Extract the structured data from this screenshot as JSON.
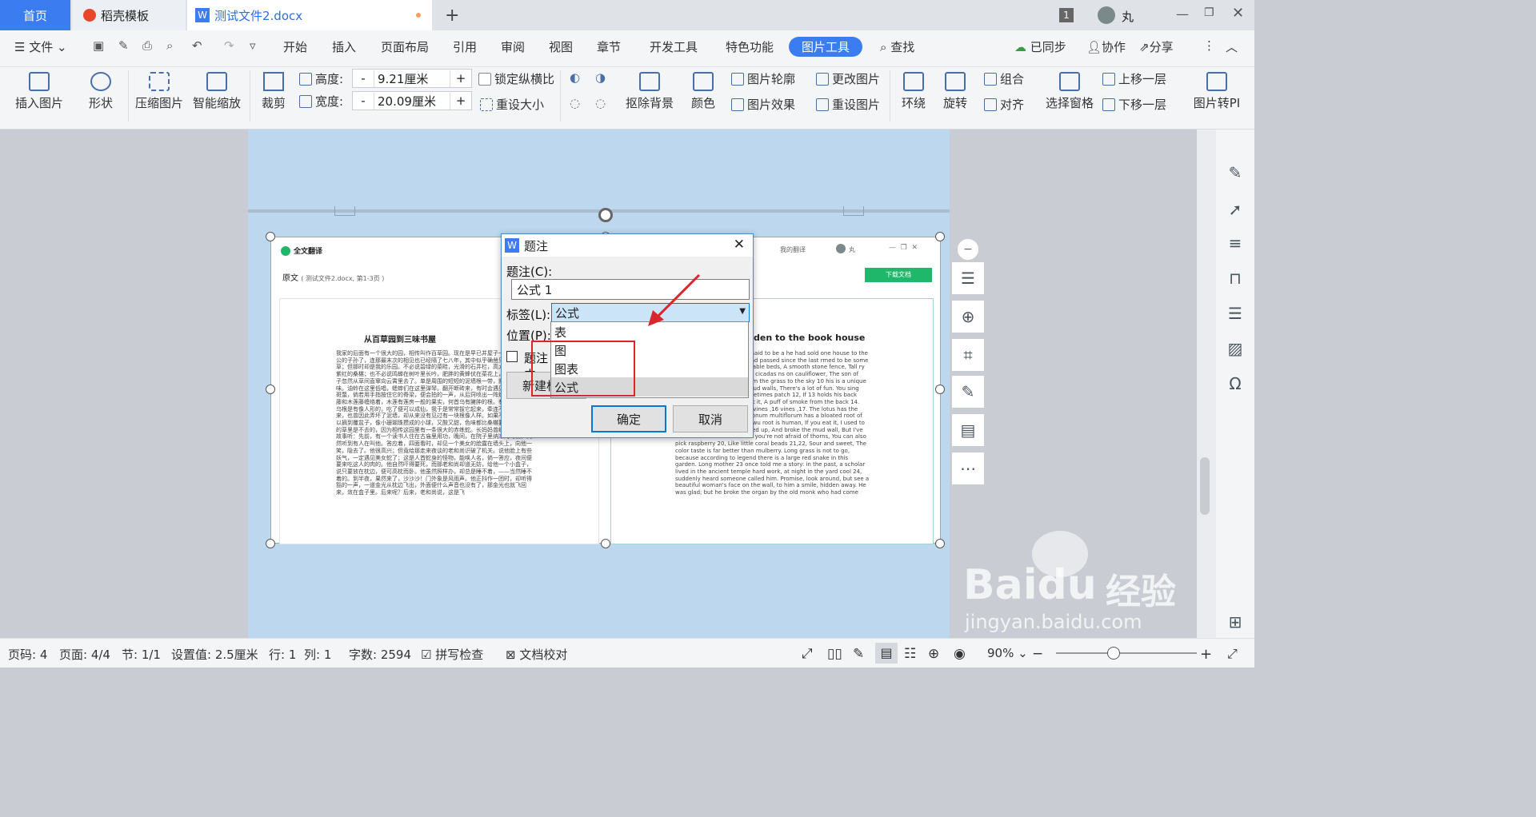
{
  "tabs": {
    "home": "首页",
    "template": "稻壳模板",
    "document": "测试文件2.docx",
    "new_tab": "+",
    "user": "丸",
    "badge": "1"
  },
  "menu": {
    "file": "文件",
    "items": [
      "开始",
      "插入",
      "页面布局",
      "引用",
      "审阅",
      "视图",
      "章节",
      "开发工具",
      "特色功能",
      "图片工具"
    ],
    "search": "查找",
    "synced": "已同步",
    "collab": "协作",
    "share": "分享"
  },
  "ribbon": {
    "insert_picture": "插入图片",
    "shape": "形状",
    "compress": "压缩图片",
    "smart_zoom": "智能缩放",
    "crop": "裁剪",
    "height_label": "高度:",
    "height_value": "9.21厘米",
    "width_label": "宽度:",
    "width_value": "20.09厘米",
    "lock_ratio": "锁定纵横比",
    "reset_size": "重设大小",
    "remove_bg": "抠除背景",
    "color": "颜色",
    "outline": "图片轮廓",
    "effect": "图片效果",
    "change_pic": "更改图片",
    "reset_pic": "重设图片",
    "wrap": "环绕",
    "rotate": "旋转",
    "group": "组合",
    "align": "对齐",
    "select_pane": "选择窗格",
    "bring_forward": "上移一层",
    "send_backward": "下移一层",
    "pic_to_pdf": "图片转PI"
  },
  "inner": {
    "app_name": "全文翻译",
    "source_label": "原文",
    "source_meta": "( 测试文件2.docx, 第1-3页 )",
    "my_translation": "我的翻译",
    "user": "丸",
    "download": "下载文档",
    "cn_title": "从百草园到三味书屋",
    "en_title": "den to the book house",
    "cn_body": "我家的后面有一个很大的园，相传叫作百草园。现在是早已并屋子一起卖给朱文公的子孙了，连那最末次的相见也已经隔了七八年，其中似乎确凿只有一些野草；但那时却是我的乐园。不必说碧绿的菜畦，光滑的石井栏，高大的皂荚树，紫红的桑椹；也不必说鸣蝉在树叶里长吟，肥胖的黄蜂伏在菜花上，轻捷的叫天子忽然从草间直窜向云霄里去了。单是周围的短短的泥墙根一带，就有无限趣味。油蛉在这里低唱，蟋蟀们在这里弹琴。翻开断砖来，有时会遇见蜈蚣；还有斑蝥，倘若用手指按住它的脊梁，便会拍的一声，从后窍喷出一阵烟雾。何首乌藤和木莲藤缠络着，木莲有莲房一般的果实，何首乌有臃肿的根。有人说，何首乌根是有像人形的，吃了便可以成仙，我于是常常拔它起来，牵连不断地拔起来，也曾因此弄坏了泥墙，却从来没有见过有一块根像人样。如果不怕刺，还可以摘到覆盆子，像小珊瑚珠攒成的小球，又酸又甜，色味都比桑椹要好得远。长的草里是不去的，因为相传这园里有一条很大的赤练蛇。长妈妈曾经讲给我一个故事听：先前，有一个读书人住在古庙里用功，晚间，在院子里纳凉的时候，突然听到有人在叫他。答应着，四面看时，却见一个美女的脸露在墙头上，向他一笑，隐去了。他很高兴；但竟给那走来夜谈的老和尚识破了机关。说他脸上有些妖气，一定遇见美女蛇了；这是人首蛇身的怪物，能唤人名，倘一答应，夜间便要来吃这人的肉的。他自然吓得要死，而那老和尚却道无妨，给他一个小盒子，说只要放在枕边，便可高枕而卧。他虽然照样办，却总是睡不着，——当然睡不着的。到半夜，果然来了，沙沙沙！门外象是风雨声。他正抖作一团时，却听得豁的一声，一道金光从枕边飞出，外面便什么声音也没有了，那金光也就飞回来，敛在盒子里。后来呢？后来，老和尚说，这是飞",
    "en_body": "behind my house, which is said to be a he had sold one house to the children of or eight years had passed since the last rmed to be some weeds; but it was my vegetable beds, A smooth stone fence, Tall ry 6: It doesn't have to be that cicadas ns on cauliflower, The son of Heaven 9the ddenly ran from the grass to the sky 10 his is a unique taste. Here the oil cricket mud walls, There's a lot of fun. You sing Open the broken brick, Sometimes patch 12, If 13 holds his back with his finger, And I'll shoot it, A puff of smoke from the back 14. Polygonum multiflorum ,15 vines ,16 vines ,17. The lotus has the fruit of a lotus house, Polygonum multiflorum has a bloated root of 19. Someone said, He Shouwu root is human, If you eat it, I used to pull it up, And it's been pulled up, And broke the mud wall, But I've never seen a human root. If you're not afraid of thorns, You can also pick raspberry 20, Like little coral beads 21,22, Sour and sweet, The color taste is far better than mulberry. Long grass is not to go, because according to legend there is a large red snake in this garden. Long mother 23 once told me a story: in the past, a scholar lived in the ancient temple hard work, at night in the yard cool 24, suddenly heard someone called him. Promise, look around, but see a beautiful woman's face on the wall, to him a smile, hidden away. He was glad; but he broke the organ by the old monk who had come"
  },
  "dialog": {
    "title": "题注",
    "caption_label": "题注(C):",
    "caption_value": "公式 1",
    "tag_label": "标签(L):",
    "tag_value": "公式",
    "position_label": "位置(P):",
    "exclude_label": "题注中",
    "new_tag": "新建标签",
    "ok": "确定",
    "cancel": "取消",
    "options": [
      "表",
      "图",
      "图表",
      "公式"
    ]
  },
  "status": {
    "page_code": "页码: 4",
    "page": "页面: 4/4",
    "section": "节: 1/1",
    "setting": "设置值: 2.5厘米",
    "row": "行: 1",
    "col": "列: 1",
    "words": "字数: 2594",
    "spell": "拼写检查",
    "proof": "文档校对",
    "zoom": "90%"
  },
  "watermark": {
    "brand": "Baidu",
    "brand_cn": "经验",
    "url": "jingyan.baidu.com"
  },
  "colors": {
    "accent": "#3b7cf0",
    "selection": "#cce4f7",
    "highlight_box": "#d9262c",
    "page_bg": "#bdd7ee"
  }
}
